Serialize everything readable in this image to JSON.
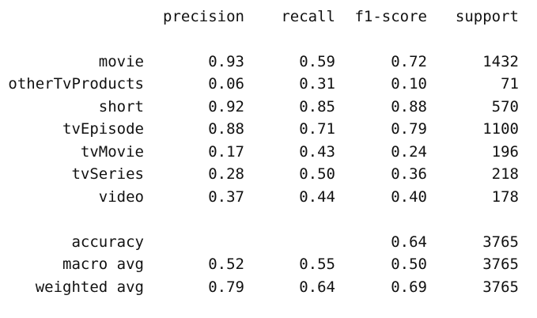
{
  "report": {
    "headers": {
      "precision": "precision",
      "recall": "recall",
      "f1": "f1-score",
      "support": "support"
    },
    "rows": [
      {
        "label": "movie",
        "precision": "0.93",
        "recall": "0.59",
        "f1": "0.72",
        "support": "1432"
      },
      {
        "label": "otherTvProducts",
        "precision": "0.06",
        "recall": "0.31",
        "f1": "0.10",
        "support": "71"
      },
      {
        "label": "short",
        "precision": "0.92",
        "recall": "0.85",
        "f1": "0.88",
        "support": "570"
      },
      {
        "label": "tvEpisode",
        "precision": "0.88",
        "recall": "0.71",
        "f1": "0.79",
        "support": "1100"
      },
      {
        "label": "tvMovie",
        "precision": "0.17",
        "recall": "0.43",
        "f1": "0.24",
        "support": "196"
      },
      {
        "label": "tvSeries",
        "precision": "0.28",
        "recall": "0.50",
        "f1": "0.36",
        "support": "218"
      },
      {
        "label": "video",
        "precision": "0.37",
        "recall": "0.44",
        "f1": "0.40",
        "support": "178"
      }
    ],
    "summary": [
      {
        "label": "accuracy",
        "precision": "",
        "recall": "",
        "f1": "0.64",
        "support": "3765"
      },
      {
        "label": "macro avg",
        "precision": "0.52",
        "recall": "0.55",
        "f1": "0.50",
        "support": "3765"
      },
      {
        "label": "weighted avg",
        "precision": "0.79",
        "recall": "0.64",
        "f1": "0.69",
        "support": "3765"
      }
    ]
  }
}
